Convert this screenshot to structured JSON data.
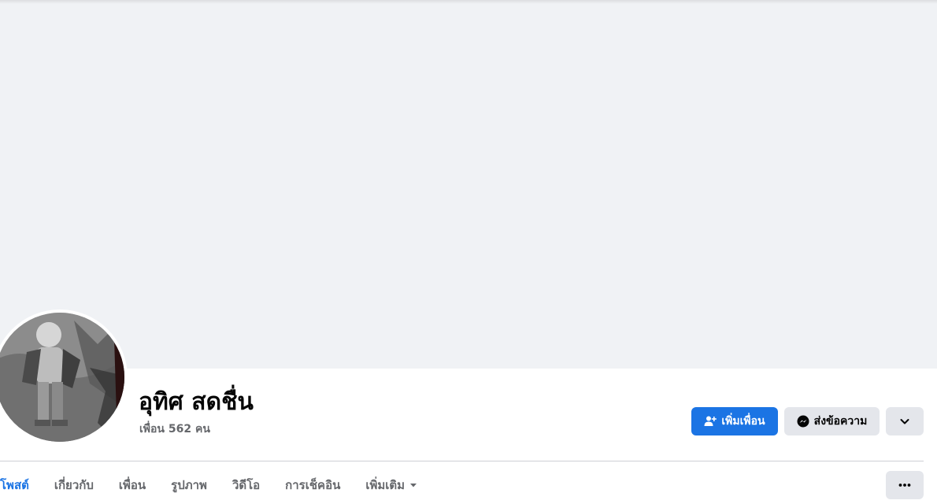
{
  "profile": {
    "name": "อุทิศ สดชื่น",
    "friends_label": "เพื่อน 562 คน"
  },
  "actions": {
    "add_friend_label": "เพิ่มเพื่อน",
    "message_label": "ส่งข้อความ",
    "add_friend_icon": "person-add-icon",
    "message_icon": "messenger-icon",
    "more_icon": "chevron-down-icon"
  },
  "tabs": [
    {
      "label": "โพสต์",
      "active": true
    },
    {
      "label": "เกี่ยวกับ",
      "active": false
    },
    {
      "label": "เพื่อน",
      "active": false
    },
    {
      "label": "รูปภาพ",
      "active": false
    },
    {
      "label": "วิดีโอ",
      "active": false
    },
    {
      "label": "การเช็คอิน",
      "active": false
    },
    {
      "label": "เพิ่มเติม",
      "active": false
    }
  ],
  "tab_options_icon": "ellipsis-icon",
  "colors": {
    "accent": "#1b74e4",
    "cover_bg": "#f0f2f5",
    "secondary_button_bg": "#e4e6eb",
    "secondary_text": "#65676b"
  }
}
